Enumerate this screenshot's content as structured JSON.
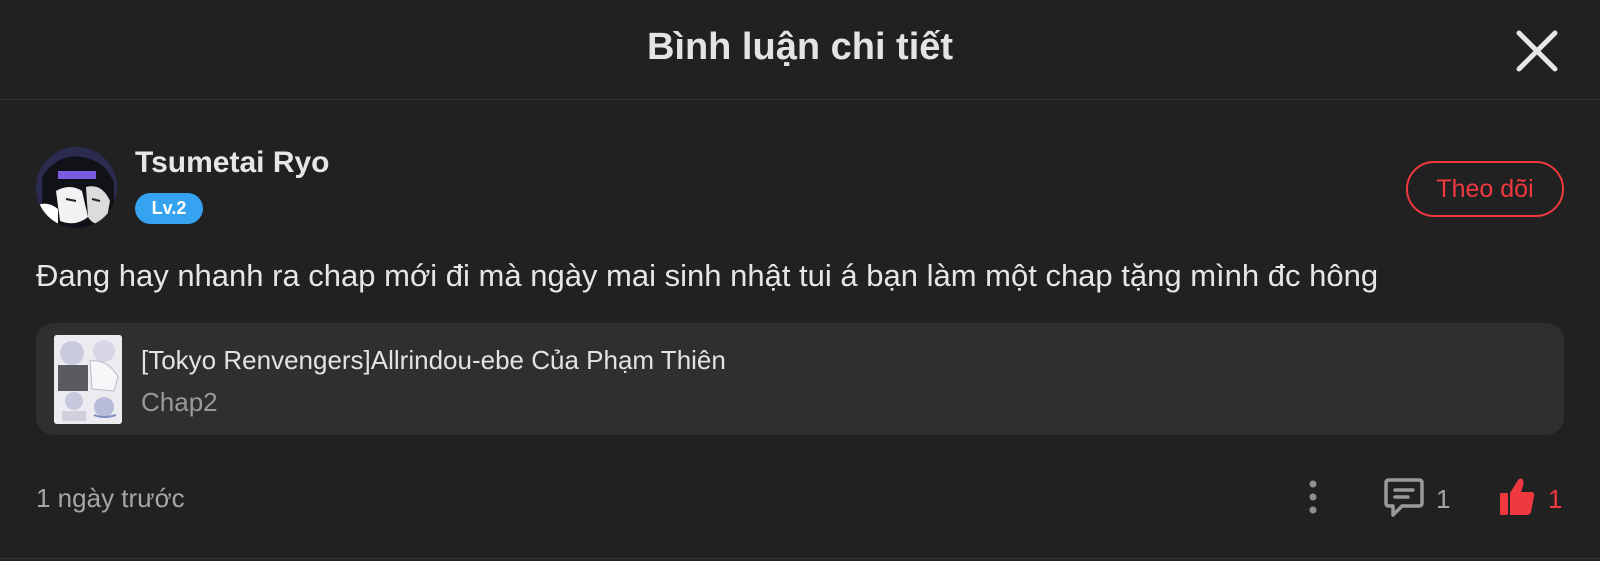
{
  "header": {
    "title": "Bình luận chi tiết",
    "close_icon": "close-icon"
  },
  "comment": {
    "author": {
      "name": "Tsumetai Ryo",
      "level": "Lv.2",
      "avatar": "avatar"
    },
    "follow_label": "Theo dõi",
    "text": "Đang hay nhanh ra chap mới đi mà ngày mai sinh nhật tui á bạn làm một chap tặng mình đc hông",
    "story": {
      "title": "[Tokyo Renvengers]Allrindou-ebe Của Phạm Thiên",
      "chapter": "Chap2"
    },
    "time": "1 ngày trước",
    "reply_count": "1",
    "like_count": "1"
  },
  "colors": {
    "background": "#212121",
    "accent_red": "#f0393f",
    "level_blue": "#36a3f0",
    "card": "#2f2f2f"
  },
  "icons": [
    "close-icon",
    "more-vertical-icon",
    "comment-icon",
    "thumbs-up-icon"
  ]
}
